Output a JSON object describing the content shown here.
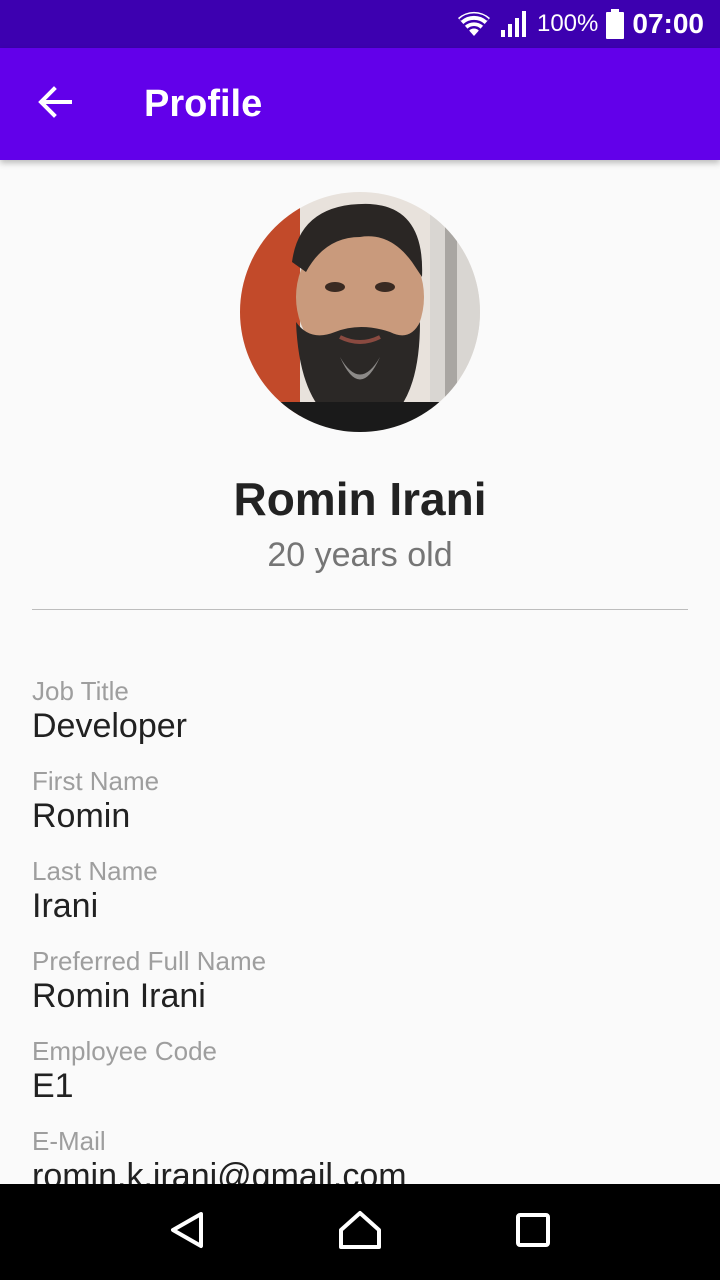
{
  "status_bar": {
    "icons": [
      "wifi-icon",
      "signal-icon",
      "battery-icon"
    ],
    "battery": "100%",
    "time": "07:00"
  },
  "app_bar": {
    "back_icon": "arrow-back-icon",
    "title": "Profile",
    "color": "#6200ea"
  },
  "profile": {
    "avatar": "profile-photo",
    "name": "Romin Irani",
    "age": "20 years old"
  },
  "fields": [
    {
      "label": "Job Title",
      "value": "Developer"
    },
    {
      "label": "First Name",
      "value": "Romin"
    },
    {
      "label": "Last Name",
      "value": "Irani"
    },
    {
      "label": "Preferred Full Name",
      "value": "Romin Irani"
    },
    {
      "label": "Employee Code",
      "value": "E1"
    },
    {
      "label": "E-Mail",
      "value": "romin.k.irani@gmail.com"
    }
  ],
  "nav_bar": {
    "icons": [
      "back-triangle-icon",
      "home-icon",
      "recents-icon"
    ]
  },
  "colors": {
    "status_bar": "#3d00b0",
    "accent": "#6200ea",
    "background": "#fafafa"
  }
}
